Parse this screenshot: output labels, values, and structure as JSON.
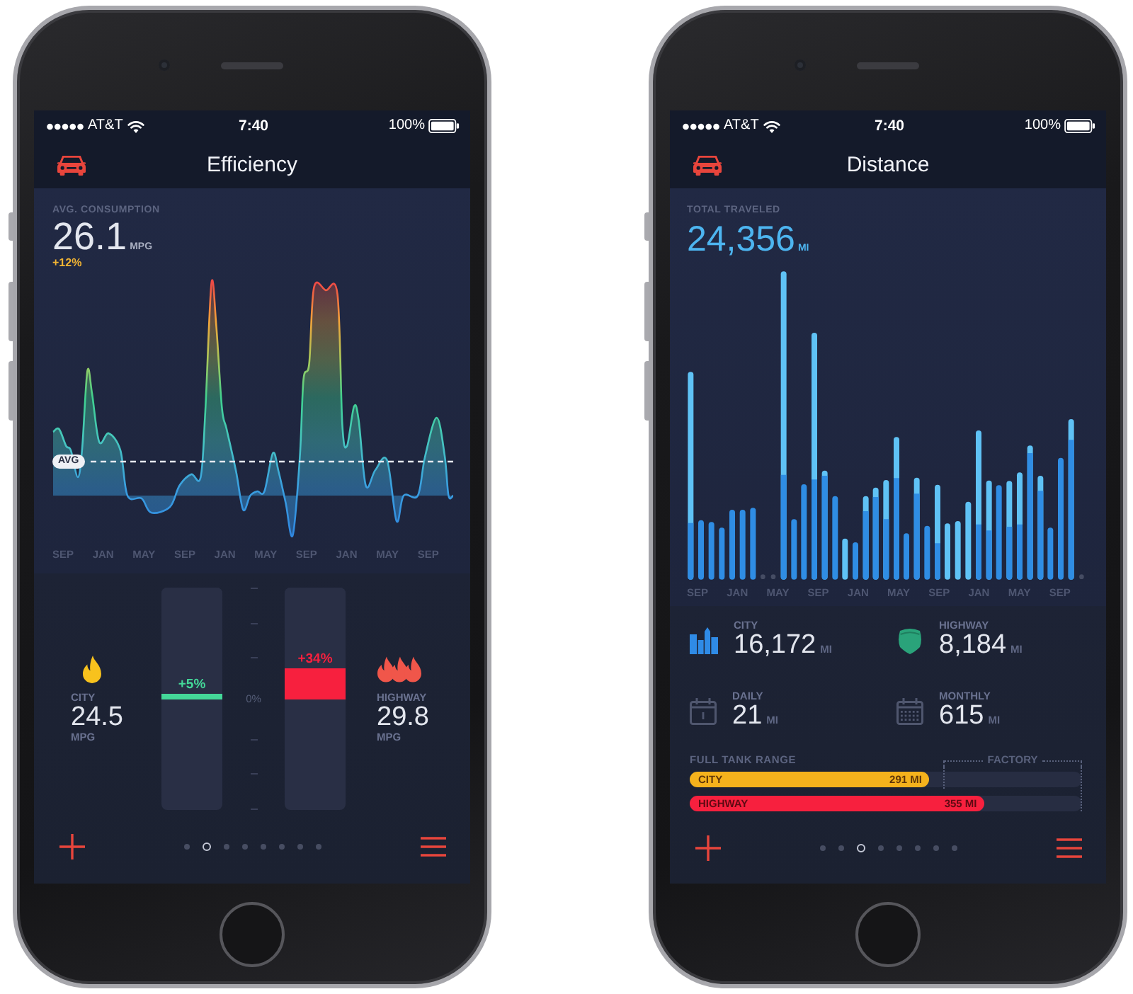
{
  "phones": [
    {
      "kind": "efficiency",
      "status_bar": {
        "carrier": "AT&T",
        "time": "7:40",
        "battery": "100%"
      },
      "nav_bar": {
        "title": "Efficiency"
      },
      "summary": {
        "label": "AVG. CONSUMPTION",
        "value": "26.1",
        "unit": "MPG",
        "change": "+12%"
      },
      "chart": {
        "average_label": "AVG",
        "month_labels": [
          "SEP",
          "JAN",
          "MAY",
          "SEP",
          "JAN",
          "MAY",
          "SEP",
          "JAN",
          "MAY",
          "SEP"
        ]
      },
      "comparison": {
        "zero_label": "0%",
        "items": [
          {
            "kind": "city",
            "label": "CITY",
            "value": "24.5",
            "unit": "MPG",
            "change": "+5%",
            "level": 0.05,
            "color": "#44d899"
          },
          {
            "kind": "highway",
            "label": "HIGHWAY",
            "value": "29.8",
            "unit": "MPG",
            "change": "+34%",
            "level": 0.28,
            "color": "#f7203e"
          }
        ]
      },
      "page_dots": [
        {
          "selected": false
        },
        {
          "selected": true
        },
        {
          "selected": false
        },
        {
          "selected": false
        },
        {
          "selected": false
        },
        {
          "selected": false
        },
        {
          "selected": false
        },
        {
          "selected": false
        }
      ]
    },
    {
      "kind": "distance",
      "status_bar": {
        "carrier": "AT&T",
        "time": "7:40",
        "battery": "100%"
      },
      "nav_bar": {
        "title": "Distance"
      },
      "summary": {
        "label": "TOTAL TRAVELED",
        "value": "24,356",
        "unit": "MI"
      },
      "chart": {
        "month_labels": [
          "SEP",
          "JAN",
          "MAY",
          "SEP",
          "JAN",
          "MAY",
          "SEP",
          "JAN",
          "MAY",
          "SEP"
        ]
      },
      "stats": [
        {
          "kind": "city",
          "label": "CITY",
          "value": "16,172",
          "unit": "MI"
        },
        {
          "kind": "highway",
          "label": "HIGHWAY",
          "value": "8,184",
          "unit": "MI"
        },
        {
          "kind": "daily",
          "label": "DAILY",
          "value": "21",
          "unit": "MI"
        },
        {
          "kind": "monthly",
          "label": "MONTHLY",
          "value": "615",
          "unit": "MI"
        }
      ],
      "range": {
        "title": "FULL TANK RANGE",
        "factory_label": "FACTORY",
        "bars": [
          {
            "label": "CITY",
            "reading": "291 MI",
            "level": 0.61,
            "color": "#f5b21c"
          },
          {
            "label": "HIGHWAY",
            "reading": "355 MI",
            "level": 0.75,
            "color": "#f7203e"
          }
        ]
      },
      "page_dots": [
        {
          "selected": false
        },
        {
          "selected": false
        },
        {
          "selected": true
        },
        {
          "selected": false
        },
        {
          "selected": false
        },
        {
          "selected": false
        },
        {
          "selected": false
        },
        {
          "selected": false
        }
      ]
    }
  ]
}
